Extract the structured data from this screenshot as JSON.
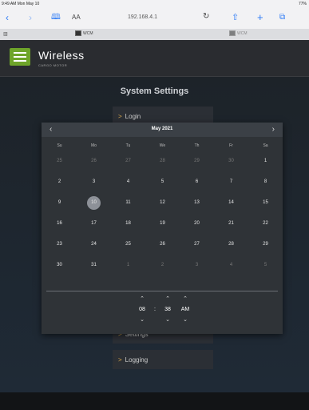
{
  "status_bar": {
    "time": "9:49 AM  Mon May 10",
    "battery": "77%"
  },
  "browser": {
    "url": "192.168.4.1",
    "aa": "AA",
    "icons": {
      "back": "back-arrow-icon",
      "forward": "forward-arrow-icon",
      "bookmarks": "book-icon",
      "reload": "reload-icon",
      "share": "share-icon",
      "add": "plus-icon",
      "tabs": "tabs-icon"
    },
    "tabs": [
      {
        "label": "WCM"
      },
      {
        "label": "WCM"
      }
    ]
  },
  "app": {
    "brand": "Wireless",
    "brand_sub": "CARGO MOTOR"
  },
  "page": {
    "title": "System Settings",
    "menu": [
      {
        "label": "Login"
      },
      {
        "label": "Settings"
      },
      {
        "label": "Logging"
      }
    ]
  },
  "datepicker": {
    "month_label": "May 2021",
    "weekdays": [
      "Su",
      "Mo",
      "Tu",
      "We",
      "Th",
      "Fr",
      "Sa"
    ],
    "weeks": [
      [
        "25",
        "26",
        "27",
        "28",
        "29",
        "30",
        "1"
      ],
      [
        "2",
        "3",
        "4",
        "5",
        "6",
        "7",
        "8"
      ],
      [
        "9",
        "10",
        "11",
        "12",
        "13",
        "14",
        "15"
      ],
      [
        "16",
        "17",
        "18",
        "19",
        "20",
        "21",
        "22"
      ],
      [
        "23",
        "24",
        "25",
        "26",
        "27",
        "28",
        "29"
      ],
      [
        "30",
        "31",
        "1",
        "2",
        "3",
        "4",
        "5"
      ]
    ],
    "muted_cells": [
      [
        0,
        0
      ],
      [
        0,
        1
      ],
      [
        0,
        2
      ],
      [
        0,
        3
      ],
      [
        0,
        4
      ],
      [
        0,
        5
      ],
      [
        5,
        2
      ],
      [
        5,
        3
      ],
      [
        5,
        4
      ],
      [
        5,
        5
      ],
      [
        5,
        6
      ]
    ],
    "selected_cell": [
      2,
      1
    ],
    "time": {
      "hour": "08",
      "separator": ":",
      "minute": "38",
      "period": "AM"
    }
  }
}
